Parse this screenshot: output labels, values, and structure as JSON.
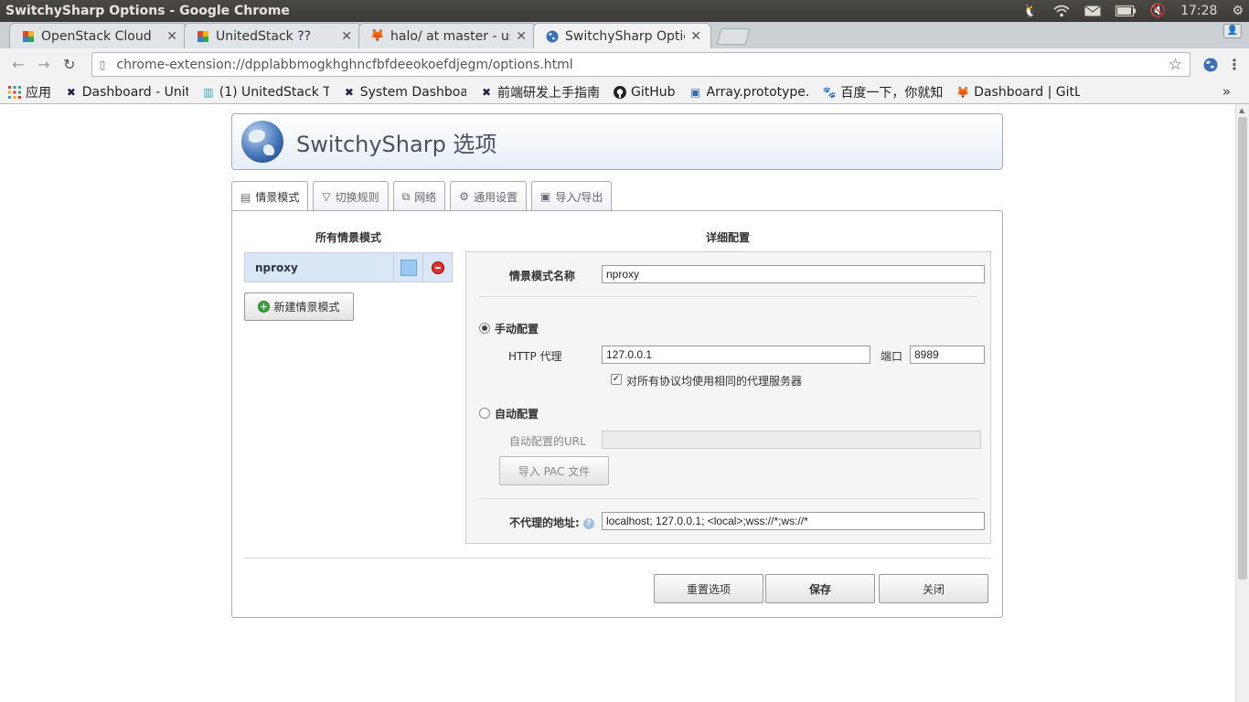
{
  "window": {
    "title": "SwitchySharp Options - Google Chrome"
  },
  "tray": {
    "time": "17:28"
  },
  "tabs": [
    {
      "label": "OpenStack Cloud",
      "icon": "openstack-icon"
    },
    {
      "label": "UnitedStack ??",
      "icon": "openstack-icon"
    },
    {
      "label": "halo/ at master - us",
      "icon": "gitlab-icon"
    },
    {
      "label": "SwitchySharp Optic",
      "icon": "globe-icon"
    }
  ],
  "omnibox": {
    "url": "chrome-extension://dpplabbmogkhghncfbfdeeokoefdjegm/options.html"
  },
  "bookmarks": [
    {
      "label": "应用",
      "icon": "apps-icon"
    },
    {
      "label": "Dashboard - Unit",
      "icon": "tools-icon"
    },
    {
      "label": "(1) UnitedStack T",
      "icon": "united-icon"
    },
    {
      "label": "System Dashboa",
      "icon": "tools-icon"
    },
    {
      "label": "前端研发上手指南",
      "icon": "tools-icon"
    },
    {
      "label": "GitHub",
      "icon": "github-icon"
    },
    {
      "label": "Array.prototype.",
      "icon": "mdn-icon"
    },
    {
      "label": "百度一下，你就知",
      "icon": "baidu-icon"
    },
    {
      "label": "Dashboard | GitL",
      "icon": "gitlab-icon"
    }
  ],
  "header": {
    "title": "SwitchySharp 选项"
  },
  "option_tabs": [
    {
      "label": "情景模式"
    },
    {
      "label": "切换规则"
    },
    {
      "label": "网络"
    },
    {
      "label": "通用设置"
    },
    {
      "label": "导入/导出"
    }
  ],
  "profiles": {
    "heading": "所有情景模式",
    "items": [
      {
        "name": "nproxy",
        "color": "#99c9f1"
      }
    ],
    "new_button": "新建情景模式"
  },
  "detail": {
    "heading": "详细配置",
    "name_label": "情景模式名称",
    "name_value": "nproxy",
    "manual_label": "手动配置",
    "http_label": "HTTP 代理",
    "http_value": "127.0.0.1",
    "port_label": "端口",
    "port_value": "8989",
    "same_proxy_label": "对所有协议均使用相同的代理服务器",
    "auto_label": "自动配置",
    "auto_url_label": "自动配置的URL",
    "auto_url_value": "",
    "import_pac_button": "导入 PAC 文件",
    "bypass_label": "不代理的地址:",
    "bypass_value": "localhost; 127.0.0.1; <local>;wss://*;ws://*"
  },
  "footer": {
    "reset_button": "重置选项",
    "save_button": "保存",
    "close_button": "关闭"
  }
}
